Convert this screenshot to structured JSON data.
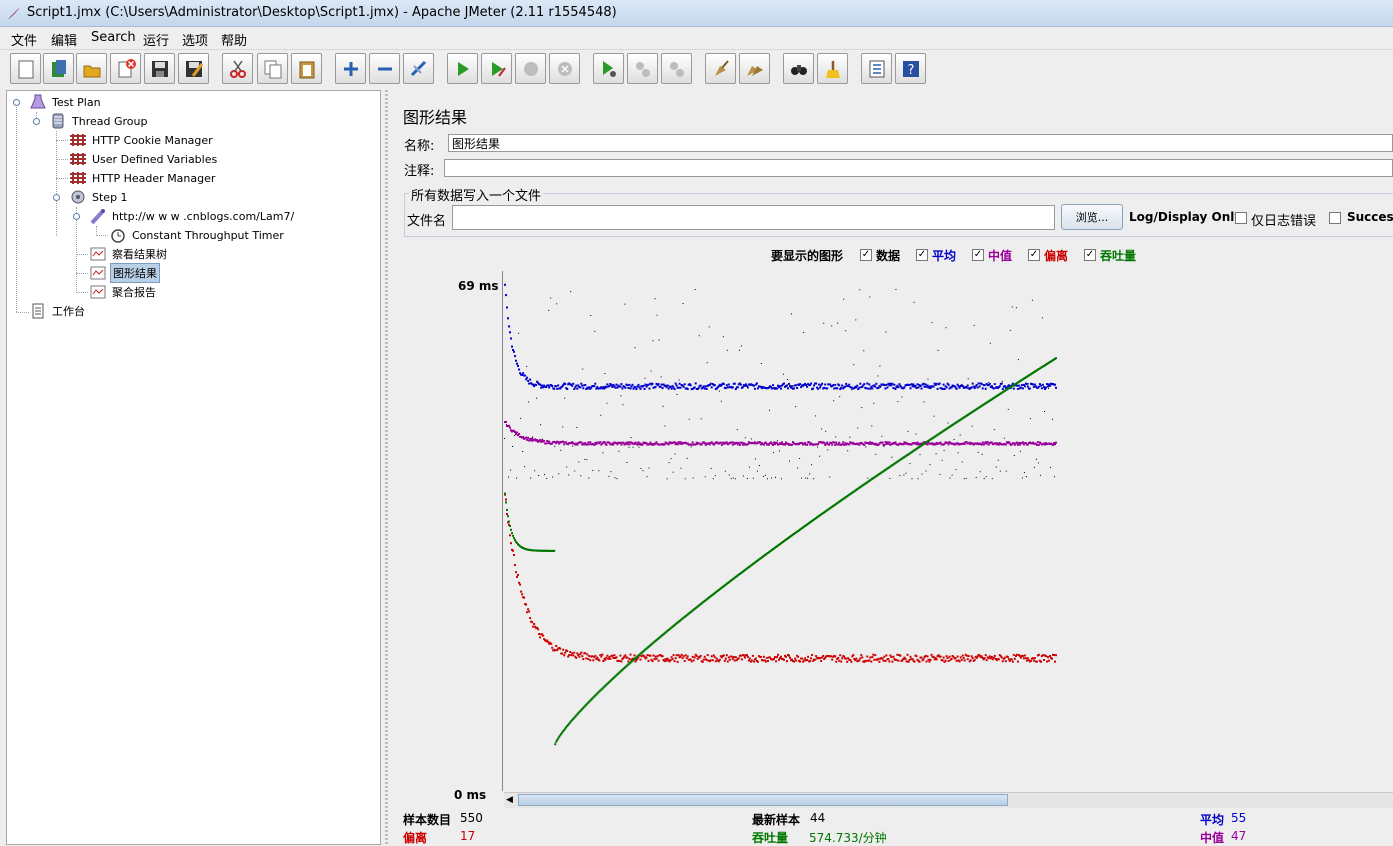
{
  "window": {
    "title": "Script1.jmx (C:\\Users\\Administrator\\Desktop\\Script1.jmx) - Apache JMeter (2.11 r1554548)"
  },
  "menu": [
    "文件",
    "编辑",
    "Search",
    "运行",
    "选项",
    "帮助"
  ],
  "toolbar": [
    "new-icon",
    "templates-icon",
    "open-icon",
    "close-icon",
    "save-icon",
    "save-as-icon",
    "cut-icon",
    "copy-icon",
    "paste-icon",
    "expand-icon",
    "collapse-icon",
    "toggle-icon",
    "start-icon",
    "start-no-pause-icon",
    "stop-icon",
    "shutdown-icon",
    "remote-start-icon",
    "remote-stop-icon",
    "remote-shutdown-icon",
    "clear-icon",
    "clear-all-icon",
    "search-icon",
    "reset-search-icon",
    "function-helper-icon",
    "help-icon"
  ],
  "tree": [
    {
      "label": "Test Plan",
      "icon": "test-plan-icon"
    },
    {
      "label": "Thread Group",
      "icon": "thread-group-icon"
    },
    {
      "label": "HTTP Cookie Manager",
      "icon": "config-element-icon"
    },
    {
      "label": "User Defined Variables",
      "icon": "config-element-icon"
    },
    {
      "label": "HTTP Header Manager",
      "icon": "config-element-icon"
    },
    {
      "label": "Step 1",
      "icon": "controller-icon"
    },
    {
      "label": "http://w w w .cnblogs.com/Lam7/",
      "icon": "sampler-icon"
    },
    {
      "label": "Constant Throughput Timer",
      "icon": "timer-icon"
    },
    {
      "label": "察看结果树",
      "icon": "listener-icon"
    },
    {
      "label": "图形结果",
      "icon": "listener-icon",
      "selected": true
    },
    {
      "label": "聚合报告",
      "icon": "listener-icon"
    },
    {
      "label": "工作台",
      "icon": "workbench-icon"
    }
  ],
  "panel": {
    "title": "图形结果",
    "name_label": "名称:",
    "name_value": "图形结果",
    "comment_label": "注释:",
    "comment_value": "",
    "group_title": "所有数据写入一个文件",
    "filename_label": "文件名",
    "filename_value": "",
    "browse_button": "浏览...",
    "log_display_label": "Log/Display Only:",
    "errors_only_label": "仅日志错误",
    "successes_label": "Successes"
  },
  "graph_options": {
    "label": "要显示的图形",
    "items": [
      {
        "label": "数据",
        "checked": true,
        "color": "#000000"
      },
      {
        "label": "平均",
        "checked": true,
        "color": "#0000cc"
      },
      {
        "label": "中值",
        "checked": true,
        "color": "#990099"
      },
      {
        "label": "偏离",
        "checked": true,
        "color": "#cc0000"
      },
      {
        "label": "吞吐量",
        "checked": true,
        "color": "#007700"
      }
    ]
  },
  "chart_data": {
    "type": "scatter",
    "y_max_label": "69 ms",
    "y_min_label": "0 ms",
    "ylim": [
      0,
      69
    ],
    "series": [
      {
        "name": "数据",
        "color": "#000000",
        "typical_range": [
          42,
          69
        ]
      },
      {
        "name": "平均",
        "color": "#0000cc",
        "start": 69,
        "final": 55
      },
      {
        "name": "中值",
        "color": "#990099",
        "start": 50,
        "final": 47
      },
      {
        "name": "偏离",
        "color": "#cc0000",
        "start": 40,
        "final": 17
      },
      {
        "name": "吞吐量",
        "color": "#007700",
        "start": 32,
        "final": 59
      }
    ]
  },
  "stats": {
    "samples_label": "样本数目",
    "samples_value": "550",
    "latest_label": "最新样本",
    "latest_value": "44",
    "average_label": "平均",
    "average_value": "55",
    "deviation_label": "偏离",
    "deviation_value": "17",
    "throughput_label": "吞吐量",
    "throughput_value": "574.733/分钟",
    "median_label": "中值",
    "median_value": "47"
  }
}
